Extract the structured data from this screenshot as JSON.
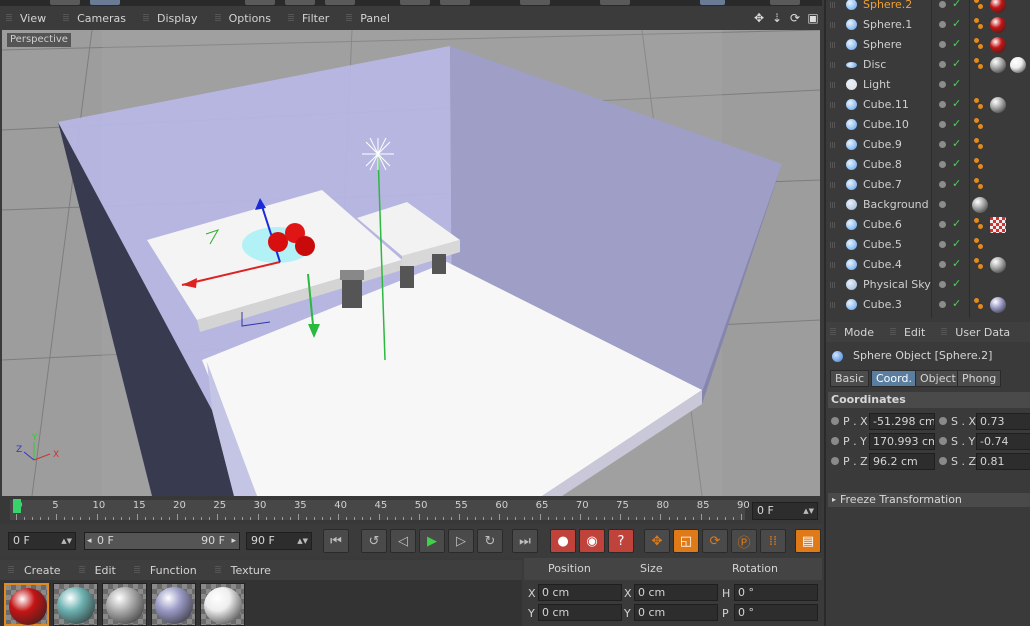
{
  "viewport": {
    "menu": [
      "View",
      "Cameras",
      "Display",
      "Options",
      "Filter",
      "Panel"
    ],
    "camera_label": "Perspective",
    "nav_icons": [
      "move-view-icon",
      "dolly-view-icon",
      "rotate-view-icon",
      "maximize-view-icon"
    ]
  },
  "timeline": {
    "ticks": [
      "0",
      "5",
      "10",
      "15",
      "20",
      "25",
      "30",
      "35",
      "40",
      "45",
      "50",
      "55",
      "60",
      "65",
      "70",
      "75",
      "80",
      "85",
      "90"
    ],
    "current_frame": "0 F",
    "start_field": "0 F",
    "range_start": "0 F",
    "range_end": "90 F",
    "end_field": "90 F"
  },
  "materials": {
    "menu": [
      "Create",
      "Edit",
      "Function",
      "Texture"
    ],
    "swatches": [
      {
        "name": "red-material",
        "color": "#c41414"
      },
      {
        "name": "teal-material",
        "color": "#6fb3b3"
      },
      {
        "name": "gray-material",
        "color": "#b0b0b0"
      },
      {
        "name": "lavender-material",
        "color": "#9c9cc8"
      },
      {
        "name": "white-material",
        "color": "#eeeeee"
      }
    ]
  },
  "coordinates": {
    "headers": [
      "Position",
      "Size",
      "Rotation"
    ],
    "rows": [
      {
        "axis": "X",
        "pos": "0 cm",
        "size_axis": "X",
        "size": "0 cm",
        "rot_axis": "H",
        "rot": "0 °"
      },
      {
        "axis": "Y",
        "pos": "0 cm",
        "size_axis": "Y",
        "size": "0 cm",
        "rot_axis": "P",
        "rot": "0 °"
      }
    ]
  },
  "objects": [
    {
      "name": "Sphere.2",
      "icon": "sphere-icon",
      "selected": true,
      "check": true,
      "tags": true,
      "mat": "#c41414",
      "mat2": ""
    },
    {
      "name": "Sphere.1",
      "icon": "sphere-icon",
      "selected": false,
      "check": true,
      "tags": true,
      "mat": "#c41414",
      "mat2": ""
    },
    {
      "name": "Sphere",
      "icon": "sphere-icon",
      "selected": false,
      "check": true,
      "tags": true,
      "mat": "#c41414",
      "mat2": ""
    },
    {
      "name": "Disc",
      "icon": "disc-icon",
      "selected": false,
      "check": true,
      "tags": true,
      "mat": "#aaaaaa",
      "mat2": "#eeeeee"
    },
    {
      "name": "Light",
      "icon": "light-icon",
      "selected": false,
      "check": true,
      "tags": false,
      "mat": "",
      "mat2": ""
    },
    {
      "name": "Cube.11",
      "icon": "cube-icon",
      "selected": false,
      "check": true,
      "tags": true,
      "mat": "#aaaaaa",
      "mat2": ""
    },
    {
      "name": "Cube.10",
      "icon": "cube-icon",
      "selected": false,
      "check": true,
      "tags": true,
      "mat": "",
      "mat2": ""
    },
    {
      "name": "Cube.9",
      "icon": "cube-icon",
      "selected": false,
      "check": true,
      "tags": true,
      "mat": "",
      "mat2": ""
    },
    {
      "name": "Cube.8",
      "icon": "cube-icon",
      "selected": false,
      "check": true,
      "tags": true,
      "mat": "",
      "mat2": ""
    },
    {
      "name": "Cube.7",
      "icon": "cube-icon",
      "selected": false,
      "check": true,
      "tags": true,
      "mat": "",
      "mat2": ""
    },
    {
      "name": "Background",
      "icon": "background-icon",
      "selected": false,
      "check": false,
      "tags": false,
      "mat": "#aaaaaa",
      "mat2": ""
    },
    {
      "name": "Cube.6",
      "icon": "cube-icon",
      "selected": false,
      "check": true,
      "tags": true,
      "mat": "checker",
      "mat2": ""
    },
    {
      "name": "Cube.5",
      "icon": "cube-icon",
      "selected": false,
      "check": true,
      "tags": true,
      "mat": "",
      "mat2": ""
    },
    {
      "name": "Cube.4",
      "icon": "cube-icon",
      "selected": false,
      "check": true,
      "tags": true,
      "mat": "#aaaaaa",
      "mat2": ""
    },
    {
      "name": "Physical Sky",
      "icon": "sky-icon",
      "selected": false,
      "check": true,
      "tags": false,
      "mat": "",
      "mat2": ""
    },
    {
      "name": "Cube.3",
      "icon": "cube-icon",
      "selected": false,
      "check": true,
      "tags": true,
      "mat": "#9c9cc8",
      "mat2": ""
    }
  ],
  "attributes": {
    "menu": [
      "Mode",
      "Edit",
      "User Data"
    ],
    "object_title": "Sphere Object [Sphere.2]",
    "tabs": [
      {
        "label": "Basic",
        "active": false
      },
      {
        "label": "Coord.",
        "active": true
      },
      {
        "label": "Object",
        "active": false
      },
      {
        "label": "Phong",
        "active": false
      }
    ],
    "section": "Coordinates",
    "fields": [
      {
        "label": "P . X",
        "value": "-51.298 cm",
        "slabel": "S . X",
        "svalue": "0.73"
      },
      {
        "label": "P . Y",
        "value": "170.993 cm",
        "slabel": "S . Y",
        "svalue": "-0.74"
      },
      {
        "label": "P . Z",
        "value": "96.2 cm",
        "slabel": "S . Z",
        "svalue": "0.81"
      }
    ],
    "freeze": "Freeze Transformation"
  }
}
